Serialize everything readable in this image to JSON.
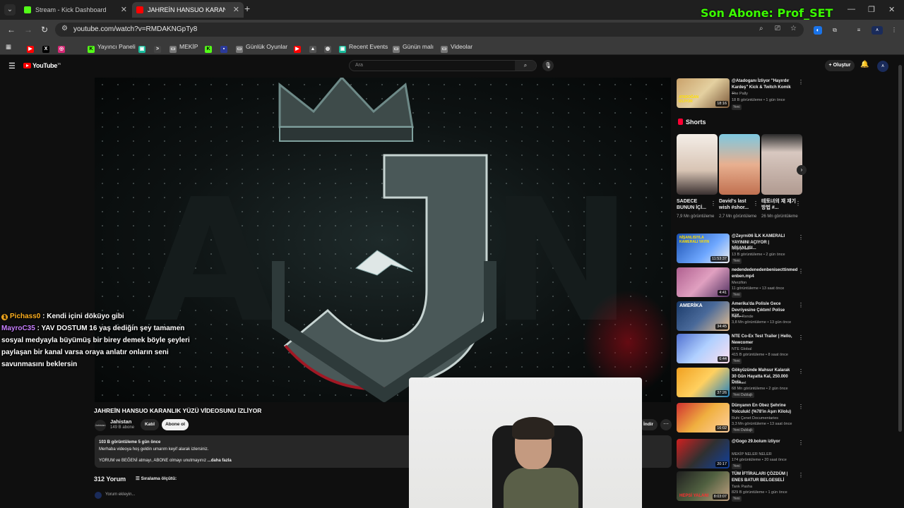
{
  "browser": {
    "tabs": [
      {
        "label": "Stream - Kick Dashboard"
      },
      {
        "label": "JAHREİN HANSUO KARANLIK YÜZÜ VİDEOSUNU İZLİYOR - YouTube"
      }
    ],
    "url": "youtube.com/watch?v=RMDAKNGpTy8",
    "bookmarks": [
      "Yayıncı Paneli",
      "MEKİP",
      "Günlük Oyunlar",
      "Recent Events",
      "Günün malı",
      "Videolar"
    ]
  },
  "overlay": {
    "subscriber_text": "Son Abone: Prof_SET",
    "chat": [
      {
        "user": "Pichass0",
        "message": ": Kendi içini döküyo gibi"
      },
      {
        "user": "MayroC35",
        "message": ": YAV DOSTUM 16 yaş dediğin şey tamamen sosyal medyayla büyümüş bir birey demek böyle şeyleri paylaşan bir kanal varsa oraya anlatır onların seni savunmasını beklersin"
      }
    ]
  },
  "youtube": {
    "logo": "YouTube",
    "country": "TR",
    "search_placeholder": "Ara",
    "create_label": "Oluştur",
    "video": {
      "title": "JAHREİN HANSUO KARANLIK YÜZÜ VİDEOSUNU İZLİYOR",
      "channel": "Jahistan",
      "subscribers": "149 B abone",
      "join_label": "Katıl",
      "subscribe_label": "Abone ol",
      "download_label": "İndir",
      "views_date": "103 B görüntüleme  5 gün önce",
      "desc_line1": "Merhaba videoya hoş geldin umarım keyif alarak izlersiniz.",
      "desc_line2": "YORUM ve BEĞENİ atmayı, ABONE olmayı unutmayınız",
      "desc_more": "...daha fazla",
      "comment_count": "312 Yorum",
      "sort_label": "Sıralama ölçütü:",
      "add_comment": "Yorum ekleyin..."
    },
    "top_rec": {
      "title": "@Atadoganı İzliyor \"Hayırdır Kardeş\" Kick & Twitch Komik ...",
      "channel": "The Pally",
      "meta": "18 B görüntüleme • 1 gün önce",
      "badge": "Yeni",
      "duration": "18:16"
    },
    "shorts_heading": "Shorts",
    "shorts": [
      {
        "title": "SADECE BUNUN İÇİ...",
        "views": "7,9 Mn görüntüleme"
      },
      {
        "title": "David's last wish #shor...",
        "views": "2,7 Mn görüntüleme"
      },
      {
        "title": "테토녀의 재 재기 방법 #...",
        "views": "26 Mn görüntüleme"
      }
    ],
    "recommendations": [
      {
        "title": "@Zeyrni06 İLK KAMERALI YAYININI AÇIYOR | NİŞANLISI...",
        "channel": "MekipHub",
        "meta": "13 B görüntüleme • 2 gün önce",
        "badge": "Yeni",
        "duration": "11:53:37"
      },
      {
        "title": "nedendedenedenbenisecttinmed enben.mp4",
        "channel": "Merzifon",
        "meta": "11 görüntüleme • 13 saat önce",
        "badge": "Yeni",
        "duration": "4:41"
      },
      {
        "title": "Amerika'da Polisle Gece Devriyesine Çıktım! Polise Küf...",
        "channel": "Alper Rende",
        "meta": "3,8 Mn görüntüleme • 13 gün önce",
        "badge": "",
        "duration": "34:45"
      },
      {
        "title": "NTE Co-Ex Test Trailer | Hello, Newcomer",
        "channel": "NTE Global",
        "meta": "415 B görüntüleme • 8 saat önce",
        "badge": "Yeni",
        "duration": "6:44"
      },
      {
        "title": "Gökyüzünde Mahsur Kalarak 30 Gün Hayatta Kal, 250.000 Dola...",
        "channel": "MrBeast",
        "meta": "68 Mn görüntüleme • 2 gün önce",
        "badge": "Yeni  Dublajlı",
        "duration": "37:26"
      },
      {
        "title": "Dünyanın En Obez Şehrine Yolculuk! (%78'in Aşırı Kilolu)",
        "channel": "Ruhi Çenet Documentaries",
        "meta": "3,3 Mn görüntüleme • 13 saat önce",
        "badge": "Yeni  Dublajlı",
        "duration": "16:02"
      },
      {
        "title": "@Gogo 29.bolum izliyor",
        "channel": "MEKİP NELER NELER",
        "meta": "174 görüntüleme • 20 saat önce",
        "badge": "Yeni",
        "duration": "20:17"
      },
      {
        "title": "TÜM İFTİRALARI ÇÖZDÜM | ENES BATUR BELGESELİ",
        "channel": "Tarık Pasha",
        "meta": "829 B görüntüleme • 1 gün önce",
        "badge": "Yeni",
        "duration": "8:03:07"
      }
    ],
    "thumb_text": {
      "top": "ATADOĞAN İZLİYOR",
      "nisan": "NİŞANLISIYLA KAMERALI YAYIN",
      "amerika": "AMERİKA",
      "hepsi": "HEPSİ YALAN!"
    }
  }
}
